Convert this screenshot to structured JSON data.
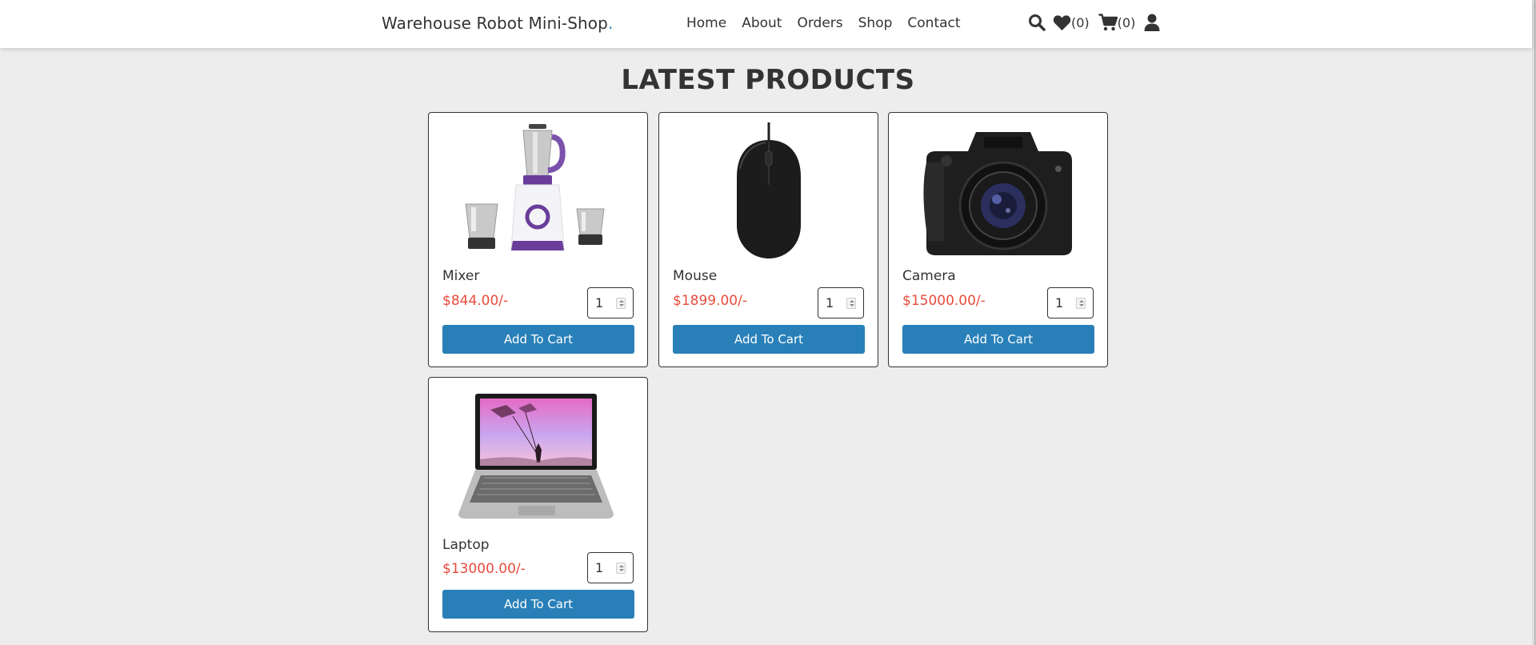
{
  "header": {
    "logo_text": "Warehouse Robot Mini-Shop",
    "logo_dot": ".",
    "nav": [
      "Home",
      "About",
      "Orders",
      "Shop",
      "Contact"
    ],
    "wishlist_count": "(0)",
    "cart_count": "(0)",
    "icons": [
      "search-icon",
      "heart-icon",
      "cart-icon",
      "user-icon"
    ]
  },
  "main": {
    "title": "LATEST PRODUCTS",
    "products": [
      {
        "name": "Mixer",
        "price": "$844.00/-",
        "qty": "1",
        "button": "Add To Cart",
        "image": "mixer-image"
      },
      {
        "name": "Mouse",
        "price": "$1899.00/-",
        "qty": "1",
        "button": "Add To Cart",
        "image": "mouse-image"
      },
      {
        "name": "Camera",
        "price": "$15000.00/-",
        "qty": "1",
        "button": "Add To Cart",
        "image": "camera-image"
      },
      {
        "name": "Laptop",
        "price": "$13000.00/-",
        "qty": "1",
        "button": "Add To Cart",
        "image": "laptop-image"
      }
    ]
  },
  "colors": {
    "accent": "#2980b9",
    "price": "#e74c3c",
    "background": "#ededed",
    "text": "#333333"
  }
}
